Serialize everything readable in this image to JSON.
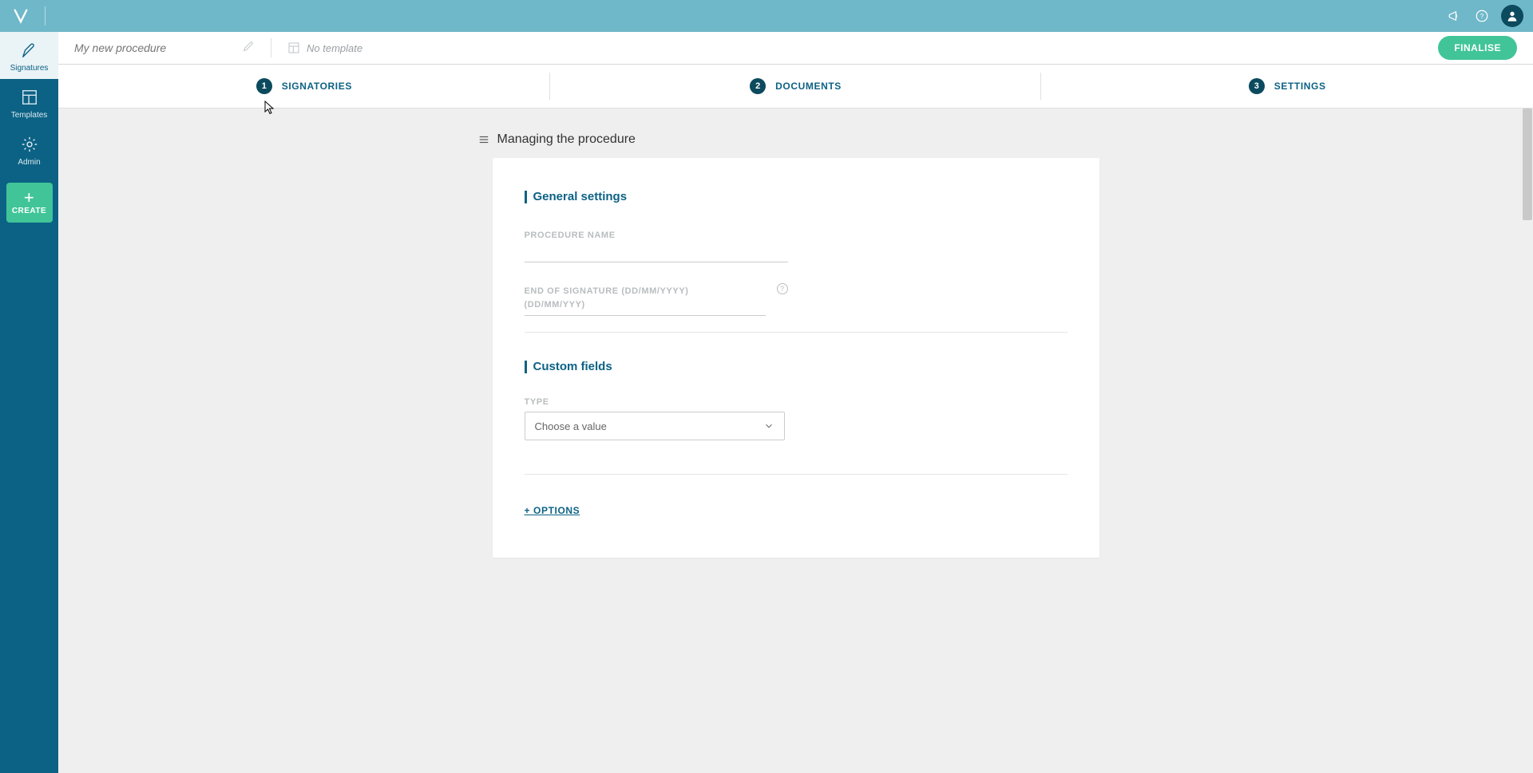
{
  "topbar": {},
  "sidebar": {
    "items": [
      {
        "label": "Signatures"
      },
      {
        "label": "Templates"
      },
      {
        "label": "Admin"
      }
    ],
    "create_label": "CREATE"
  },
  "proc_header": {
    "title_placeholder": "My new procedure",
    "template_label": "No template",
    "finalise_label": "FINALISE"
  },
  "stepper": {
    "steps": [
      {
        "num": "1",
        "label": "SIGNATORIES"
      },
      {
        "num": "2",
        "label": "DOCUMENTS"
      },
      {
        "num": "3",
        "label": "SETTINGS"
      }
    ]
  },
  "main": {
    "section_title": "Managing the procedure",
    "general": {
      "header": "General settings",
      "procedure_name_label": "PROCEDURE NAME",
      "end_signature_label": "END OF SIGNATURE (DD/MM/YYYY)",
      "end_signature_sub": "(DD/MM/YYY)"
    },
    "custom": {
      "header": "Custom fields",
      "type_label": "TYPE",
      "type_placeholder": "Choose a value"
    },
    "options_label": "+ OPTIONS"
  }
}
